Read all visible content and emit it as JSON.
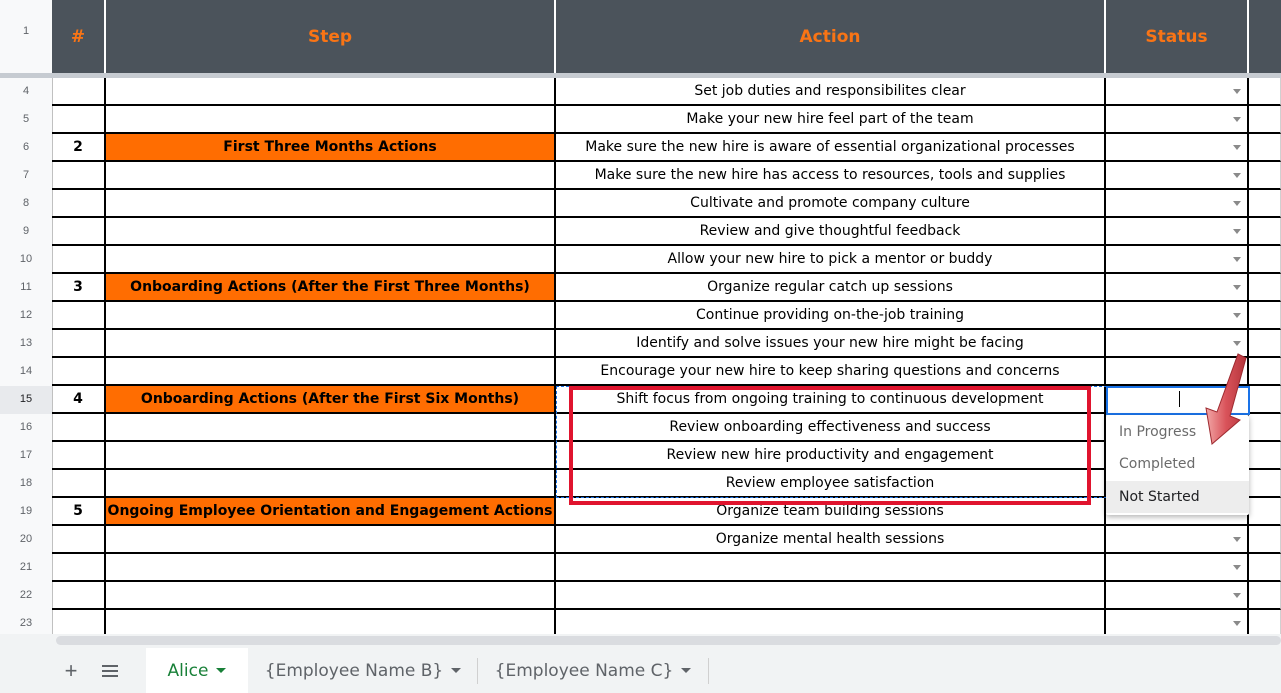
{
  "columns": [
    "#",
    "Step",
    "Action",
    "Status"
  ],
  "frozen_row_number": "1",
  "rows": [
    {
      "row": "4",
      "num": "",
      "step": "",
      "action": "Set job duties and responsibilites clear",
      "dropdown": true
    },
    {
      "row": "5",
      "num": "",
      "step": "",
      "action": "Make your new hire feel part of the team",
      "dropdown": true
    },
    {
      "row": "6",
      "num": "2",
      "step": "First Three Months Actions",
      "action": "Make sure the new hire is aware of essential organizational processes",
      "dropdown": true
    },
    {
      "row": "7",
      "num": "",
      "step": "",
      "action": "Make sure the new hire has access to resources, tools and supplies",
      "dropdown": true
    },
    {
      "row": "8",
      "num": "",
      "step": "",
      "action": "Cultivate and promote company culture",
      "dropdown": true
    },
    {
      "row": "9",
      "num": "",
      "step": "",
      "action": "Review and give thoughtful feedback",
      "dropdown": true
    },
    {
      "row": "10",
      "num": "",
      "step": "",
      "action": "Allow your new hire to pick a mentor or buddy",
      "dropdown": true
    },
    {
      "row": "11",
      "num": "3",
      "step": "Onboarding Actions (After the First Three Months)",
      "action": "Organize regular catch up sessions",
      "dropdown": true
    },
    {
      "row": "12",
      "num": "",
      "step": "",
      "action": "Continue providing on-the-job training",
      "dropdown": true
    },
    {
      "row": "13",
      "num": "",
      "step": "",
      "action": "Identify and solve issues your new hire might be facing",
      "dropdown": true
    },
    {
      "row": "14",
      "num": "",
      "step": "",
      "action": "Encourage your new hire to keep sharing questions and concerns",
      "dropdown": false
    },
    {
      "row": "15",
      "num": "4",
      "step": "Onboarding Actions (After the First Six Months)",
      "action": "Shift focus from ongoing training to continuous development",
      "dropdown": false
    },
    {
      "row": "16",
      "num": "",
      "step": "",
      "action": "Review onboarding effectiveness and success",
      "dropdown": false
    },
    {
      "row": "17",
      "num": "",
      "step": "",
      "action": "Review new hire productivity and engagement",
      "dropdown": false
    },
    {
      "row": "18",
      "num": "",
      "step": "",
      "action": "Review employee satisfaction",
      "dropdown": false
    },
    {
      "row": "19",
      "num": "5",
      "step": "Ongoing Employee Orientation and Engagement Actions",
      "action": "Organize team building sessions",
      "dropdown": true
    },
    {
      "row": "20",
      "num": "",
      "step": "",
      "action": "Organize mental health sessions",
      "dropdown": true
    },
    {
      "row": "21",
      "num": "",
      "step": "",
      "action": "",
      "dropdown": true
    },
    {
      "row": "22",
      "num": "",
      "step": "",
      "action": "",
      "dropdown": true
    },
    {
      "row": "23",
      "num": "",
      "step": "",
      "action": "",
      "dropdown": true
    }
  ],
  "selected_row": "15",
  "status_dropdown": {
    "options": [
      "In Progress",
      "Completed",
      "Not Started"
    ],
    "highlighted": "Not Started"
  },
  "sheet_tabs": [
    {
      "label": "Alice",
      "active": true
    },
    {
      "label": "{Employee Name B}",
      "active": false
    },
    {
      "label": "{Employee Name C}",
      "active": false
    }
  ],
  "icons": [
    "plus-icon",
    "menu-icon",
    "chevron-down-icon",
    "arrow-annotation-icon"
  ],
  "colors": {
    "header_bg": "#4b535b",
    "header_text": "#f97415",
    "step_fill": "#ff6d01",
    "annotation_red": "#e0142e",
    "selection_blue": "#1a73e8",
    "active_tab_text": "#188038"
  }
}
